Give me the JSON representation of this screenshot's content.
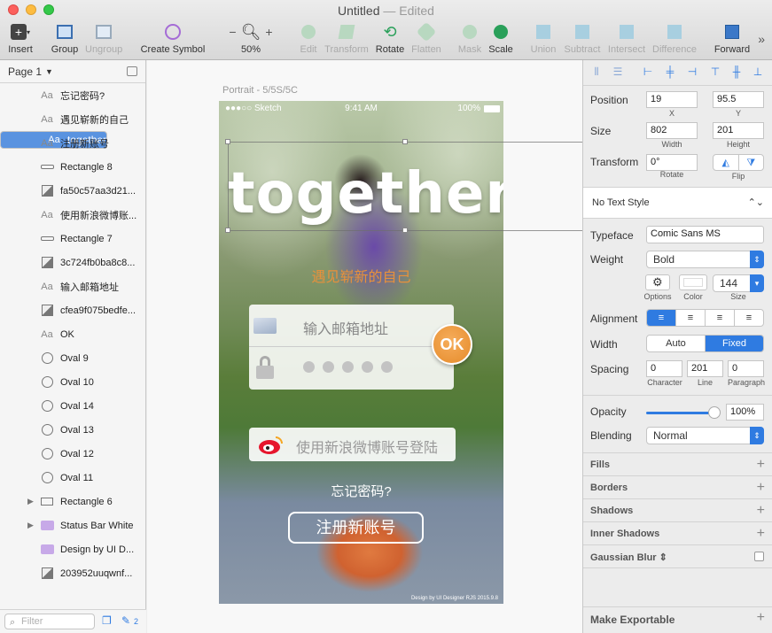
{
  "window": {
    "title": "Untitled",
    "status": "— Edited"
  },
  "toolbar": {
    "insert": "Insert",
    "group": "Group",
    "ungroup": "Ungroup",
    "create_symbol": "Create Symbol",
    "zoom_value": "50%",
    "edit": "Edit",
    "transform": "Transform",
    "rotate": "Rotate",
    "flatten": "Flatten",
    "mask": "Mask",
    "scale": "Scale",
    "union": "Union",
    "subtract": "Subtract",
    "intersect": "Intersect",
    "difference": "Difference",
    "forward": "Forward"
  },
  "pages": {
    "current": "Page 1"
  },
  "layers": [
    {
      "kind": "text",
      "name": "忘记密码?"
    },
    {
      "kind": "text",
      "name": "遇见崭新的自己"
    },
    {
      "kind": "text",
      "name": "together",
      "selected": true
    },
    {
      "kind": "text",
      "name": "注册新账号"
    },
    {
      "kind": "rect",
      "name": "Rectangle 8"
    },
    {
      "kind": "image",
      "name": "fa50c57aa3d21..."
    },
    {
      "kind": "text",
      "name": "使用新浪微博账..."
    },
    {
      "kind": "rect",
      "name": "Rectangle 7"
    },
    {
      "kind": "image",
      "name": "3c724fb0ba8c8..."
    },
    {
      "kind": "text",
      "name": "输入邮箱地址"
    },
    {
      "kind": "image",
      "name": "cfea9f075bedfe..."
    },
    {
      "kind": "text",
      "name": "OK"
    },
    {
      "kind": "oval",
      "name": "Oval 9"
    },
    {
      "kind": "oval",
      "name": "Oval 10"
    },
    {
      "kind": "oval",
      "name": "Oval 14"
    },
    {
      "kind": "oval",
      "name": "Oval 13"
    },
    {
      "kind": "oval",
      "name": "Oval 12"
    },
    {
      "kind": "oval",
      "name": "Oval 11"
    },
    {
      "kind": "group",
      "name": "Rectangle 6"
    },
    {
      "kind": "folder",
      "name": "Status Bar White"
    },
    {
      "kind": "folder2",
      "name": "Design by UI D..."
    },
    {
      "kind": "image",
      "name": "203952uuqwnf..."
    }
  ],
  "layer_aa": "Aa",
  "filter": {
    "placeholder": "Filter",
    "edit_count": "2"
  },
  "canvas": {
    "artboard_label": "Portrait - 5/5S/5C",
    "status_left": "●●●○○ Sketch",
    "status_time": "9:41 AM",
    "status_batt": "100%",
    "headline": "together",
    "subtitle": "遇见崭新的自己",
    "email_placeholder": "输入邮箱地址",
    "ok": "OK",
    "weibo": "使用新浪微博账号登陆",
    "forgot": "忘记密码?",
    "register": "注册新账号",
    "credit": "Design by UI Designer RJS    2015.9.8"
  },
  "inspector": {
    "position_label": "Position",
    "x": "19",
    "y": "95.5",
    "x_cap": "X",
    "y_cap": "Y",
    "size_label": "Size",
    "width": "802",
    "height": "201",
    "w_cap": "Width",
    "h_cap": "Height",
    "transform_label": "Transform",
    "rotate": "0°",
    "rotate_cap": "Rotate",
    "flip_cap": "Flip",
    "text_style": "No Text Style",
    "typeface_label": "Typeface",
    "typeface": "Comic Sans MS",
    "weight_label": "Weight",
    "weight": "Bold",
    "options_cap": "Options",
    "color_cap": "Color",
    "size_cap": "Size",
    "font_size": "144",
    "alignment_label": "Alignment",
    "width_label": "Width",
    "width_auto": "Auto",
    "width_fixed": "Fixed",
    "spacing_label": "Spacing",
    "character": "0",
    "line": "201",
    "paragraph": "0",
    "char_cap": "Character",
    "line_cap": "Line",
    "para_cap": "Paragraph",
    "opacity_label": "Opacity",
    "opacity": "100%",
    "blending_label": "Blending",
    "blending": "Normal",
    "fills": "Fills",
    "borders": "Borders",
    "shadows": "Shadows",
    "inner_shadows": "Inner Shadows",
    "gaussian_blur": "Gaussian Blur ⇕",
    "make_exportable": "Make Exportable"
  }
}
